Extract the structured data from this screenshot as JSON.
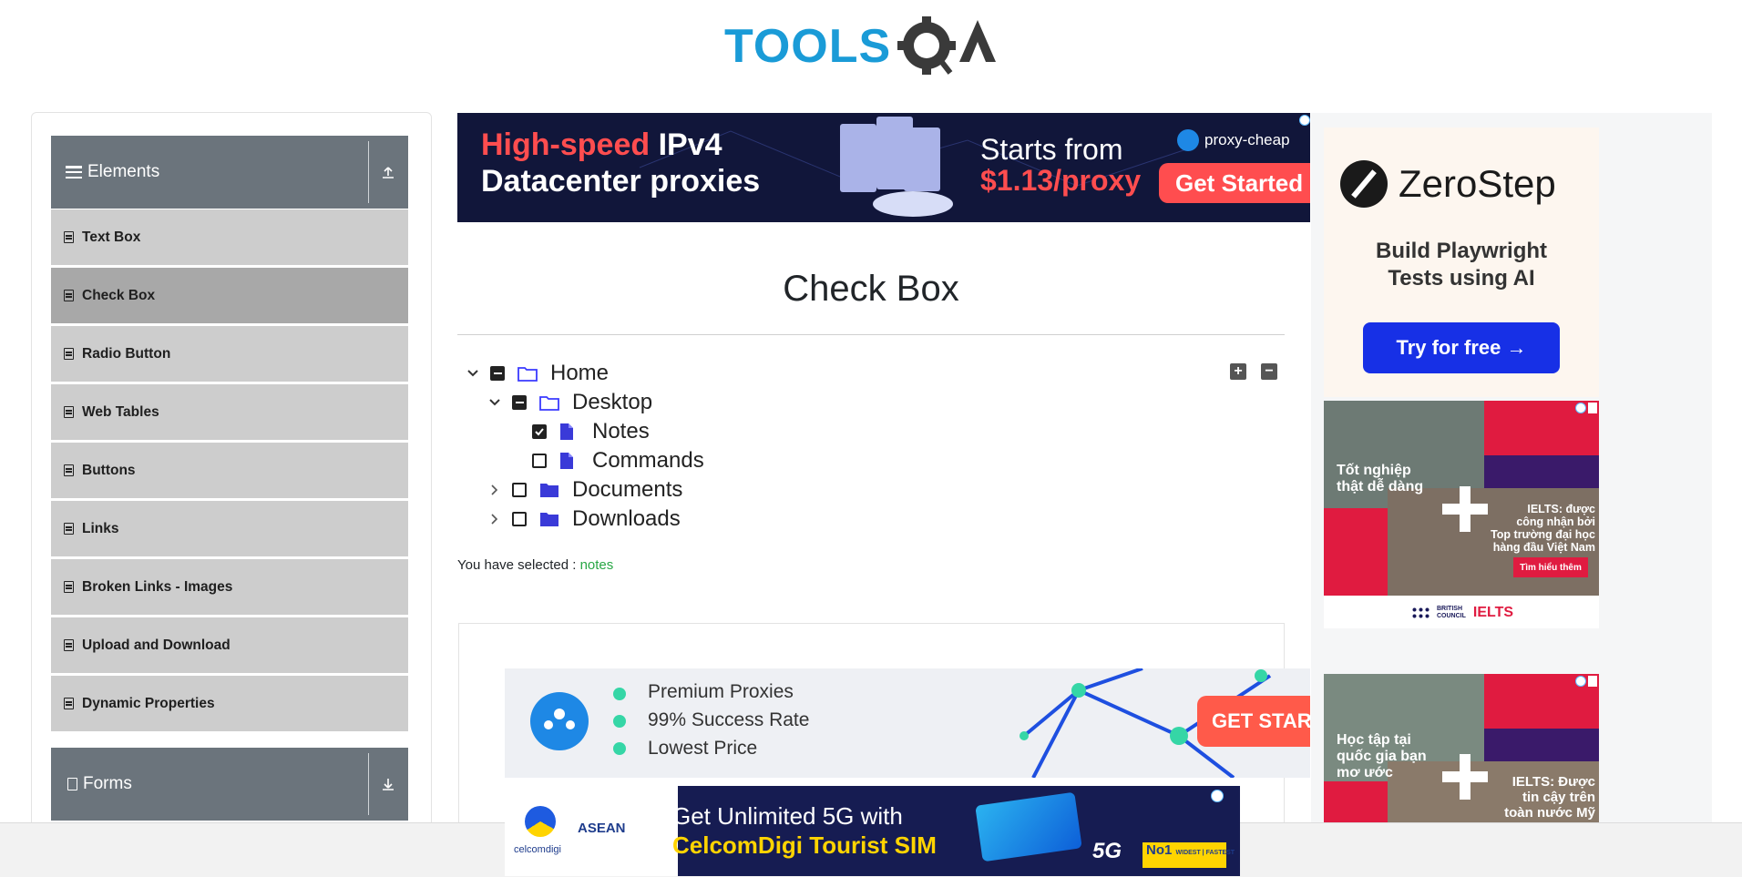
{
  "brand": {
    "logo_text_a": "TOOLS",
    "logo_text_b": "QA"
  },
  "sidebar": {
    "groups": [
      {
        "title": "Elements"
      },
      {
        "title": "Forms"
      }
    ],
    "items": [
      {
        "label": "Text Box"
      },
      {
        "label": "Check Box"
      },
      {
        "label": "Radio Button"
      },
      {
        "label": "Web Tables"
      },
      {
        "label": "Buttons"
      },
      {
        "label": "Links"
      },
      {
        "label": "Broken Links - Images"
      },
      {
        "label": "Upload and Download"
      },
      {
        "label": "Dynamic Properties"
      }
    ]
  },
  "main": {
    "title": "Check Box",
    "tree": {
      "home": "Home",
      "desktop": "Desktop",
      "notes": "Notes",
      "commands": "Commands",
      "documents": "Documents",
      "downloads": "Downloads"
    },
    "selected_label": "You have selected :",
    "selected_value": "notes"
  },
  "ads": {
    "proxy_cheap": {
      "line1a": "High-speed",
      "line1b": "IPv4",
      "line2": "Datacenter proxies",
      "starts": "Starts from",
      "price": "$1.13/proxy",
      "brand": "proxy-cheap",
      "cta": "Get Started"
    },
    "zerostep": {
      "brand": "ZeroStep",
      "line1": "Build Playwright",
      "line2": "Tests using AI",
      "cta": "Try for free →"
    },
    "proxy2": {
      "f1": "Premium Proxies",
      "f2": "99% Success Rate",
      "f3": "Lowest Price",
      "cta": "GET START"
    },
    "celcom": {
      "brand": "celcomdigi",
      "event": "ASEAN",
      "line1": "Get Unlimited 5G with",
      "line2": "CelcomDigi Tourist SIM",
      "badge": "No1",
      "badge_sub": "WIDEST | FASTEST",
      "network": "5G"
    },
    "bc1": {
      "t1": "Tốt nghiệp",
      "t2": "thật dễ dàng",
      "r1": "IELTS: được",
      "r2": "công nhận bởi",
      "r3": "Top trường đại học",
      "r4": "hàng đầu Việt Nam",
      "cta": "Tìm hiểu thêm",
      "org1": "BRITISH",
      "org2": "COUNCIL",
      "ielts": "IELTS"
    },
    "bc2": {
      "t1": "Học tập tại",
      "t2": "quốc gia bạn",
      "t3": "mơ ước",
      "r1": "IELTS: Được",
      "r2": "tin cậy trên",
      "r3": "toàn nước Mỹ"
    }
  },
  "colors": {
    "accent": "#28a745",
    "sidebar_header": "#6b747c",
    "menu_bg": "#cdcdcd",
    "menu_active": "#a8a8a8"
  }
}
